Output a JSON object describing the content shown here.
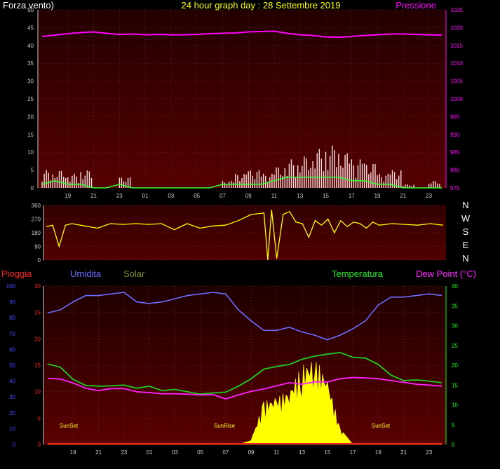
{
  "top": {
    "left_label": "Forza vento)",
    "title": "24 hour graph day : 28 Settembre 2019",
    "right_label": "Pressione"
  },
  "bottom": {
    "labels": {
      "rain": "Pioggia",
      "humidity": "Umidita",
      "solar": "Solar",
      "temperature": "Temperatura",
      "dewpoint": "Dew Point (°C)"
    },
    "annotations": [
      "SunSet",
      "SunRise",
      "SunSet"
    ]
  },
  "wind_dir_labels": [
    "N",
    "W",
    "S",
    "E",
    "N"
  ],
  "colors": {
    "pressure": "#ff00ff",
    "wind_gust": "#ffe0e0",
    "wind_avg": "#33ff33",
    "direction": "#ffff00",
    "humidity": "#6c6cff",
    "temperature": "#22cc22",
    "dewpoint": "#ff22ff",
    "solar": "#ffff00",
    "rain": "#ff2020",
    "axis_blue": "#4848ff",
    "axis_green": "#00ff00",
    "title_yellow": "#ffff00"
  },
  "chart_data": [
    {
      "type": "line",
      "name": "wind_pressure",
      "x_ticks": [
        "19",
        "21",
        "23",
        "01",
        "03",
        "05",
        "07",
        "09",
        "11",
        "13",
        "15",
        "17",
        "19",
        "21",
        "23"
      ],
      "hours": [
        17,
        18,
        19,
        20,
        21,
        22,
        23,
        0,
        1,
        2,
        3,
        4,
        5,
        6,
        7,
        8,
        9,
        10,
        11,
        12,
        13,
        14,
        15,
        16,
        17,
        18,
        19,
        20,
        21,
        22,
        23,
        24
      ],
      "y_left_ticks": [
        "50",
        "45",
        "40",
        "35",
        "30",
        "25",
        "20",
        "15",
        "10",
        "5",
        "0"
      ],
      "y_left_range": [
        0,
        50
      ],
      "y_right_ticks": [
        "1025",
        "1020",
        "1015",
        "1010",
        "1005",
        "1000",
        "995",
        "990",
        "985",
        "980",
        "975"
      ],
      "y_right_range": [
        975,
        1025
      ],
      "series": [
        {
          "name": "Pressione",
          "values": [
            1017.5,
            1017.9,
            1018.3,
            1018.6,
            1018.8,
            1018.4,
            1018.1,
            1018.2,
            1018.0,
            1018.1,
            1018.0,
            1018.0,
            1018.1,
            1018.3,
            1018.4,
            1018.5,
            1018.8,
            1018.9,
            1019.0,
            1018.4,
            1018.0,
            1017.8,
            1017.4,
            1017.3,
            1017.5,
            1017.8,
            1018.0,
            1018.2,
            1018.2,
            1018.1,
            1018.0,
            1017.9
          ]
        },
        {
          "values": [
            5,
            5,
            4,
            5,
            0,
            0,
            3,
            0,
            0,
            0,
            0,
            0,
            0,
            0,
            2,
            4,
            5,
            4,
            6,
            8,
            9,
            11,
            12,
            10,
            8,
            7,
            4,
            5,
            1,
            0,
            2,
            0
          ]
        },
        {
          "values": [
            1,
            2,
            1,
            1,
            0,
            0,
            1,
            0,
            0,
            0,
            0,
            0,
            0,
            0,
            1,
            1,
            1,
            1,
            2,
            3,
            3,
            3,
            3,
            3,
            2,
            2,
            1,
            1,
            0,
            0,
            0,
            0
          ]
        }
      ]
    },
    {
      "type": "line",
      "name": "wind_direction",
      "y_ticks": [
        "360",
        "270",
        "180",
        "90",
        "0"
      ],
      "y_range": [
        0,
        360
      ],
      "hours": [
        17,
        17.5,
        18,
        18.5,
        19,
        20,
        21,
        22,
        23,
        0,
        1,
        2,
        3,
        4,
        5,
        6,
        7,
        8,
        9,
        10,
        10.3,
        10.6,
        11,
        11.5,
        12,
        12.5,
        13,
        13.5,
        14,
        14.5,
        15,
        15.5,
        16,
        16.5,
        17,
        17.5,
        18,
        18.5,
        19,
        20,
        21,
        22,
        23,
        24
      ],
      "values": [
        220,
        230,
        90,
        230,
        240,
        225,
        210,
        240,
        235,
        240,
        235,
        240,
        200,
        240,
        210,
        225,
        230,
        260,
        300,
        310,
        0,
        330,
        10,
        300,
        320,
        250,
        240,
        150,
        260,
        230,
        270,
        180,
        260,
        220,
        250,
        240,
        210,
        250,
        230,
        240,
        235,
        230,
        240,
        230
      ]
    },
    {
      "type": "line",
      "name": "weather",
      "x_ticks": [
        "19",
        "21",
        "23",
        "01",
        "03",
        "05",
        "07",
        "09",
        "11",
        "13",
        "15",
        "17",
        "19",
        "21",
        "23"
      ],
      "y_rain_ticks": [
        "30",
        "25",
        "20",
        "15",
        "10",
        "5",
        "0"
      ],
      "y_rain_range": [
        0,
        30
      ],
      "y_humidity_ticks": [
        "100",
        "90",
        "80",
        "70",
        "60",
        "50",
        "40",
        "30",
        "20",
        "10",
        "0"
      ],
      "y_humidity_range": [
        0,
        100
      ],
      "y_temp_ticks": [
        "40",
        "35",
        "30",
        "25",
        "20",
        "15",
        "10",
        "5",
        "0"
      ],
      "y_temp_range": [
        0,
        40
      ],
      "hours": [
        17,
        18,
        19,
        20,
        21,
        22,
        23,
        0,
        1,
        2,
        3,
        4,
        5,
        6,
        7,
        8,
        9,
        10,
        11,
        12,
        13,
        14,
        15,
        16,
        17,
        18,
        19,
        20,
        21,
        22,
        23,
        24
      ],
      "series": [
        {
          "name": "Umidita",
          "values": [
            83,
            85,
            90,
            94,
            94,
            95,
            96,
            90,
            89,
            90,
            92,
            94,
            95,
            96,
            95,
            85,
            78,
            72,
            72,
            74,
            71,
            69,
            66,
            69,
            73,
            78,
            88,
            93,
            93,
            94,
            95,
            94
          ]
        },
        {
          "name": "Temperatura",
          "values": [
            20.3,
            19.5,
            16.4,
            14.9,
            14.7,
            14.8,
            15.0,
            14.2,
            14.7,
            13.6,
            13.9,
            13.3,
            12.7,
            13.0,
            13.2,
            14.7,
            16.6,
            19.0,
            19.7,
            20.2,
            21.5,
            22.3,
            22.8,
            23.2,
            22.0,
            21.8,
            20.2,
            17.5,
            16.1,
            16.3,
            16.0,
            15.6
          ]
        },
        {
          "name": "Dew Point (°C)",
          "values": [
            16.7,
            16.5,
            15.5,
            14.2,
            13.6,
            14.1,
            14.1,
            13.3,
            13.1,
            12.8,
            12.8,
            12.7,
            12.5,
            12.6,
            11.5,
            12.5,
            13.4,
            14.0,
            14.8,
            15.6,
            15.2,
            15.8,
            15.8,
            16.6,
            16.9,
            16.8,
            16.6,
            16.1,
            15.7,
            15.2,
            15.0,
            14.7
          ]
        },
        {
          "name": "Solar",
          "values": [
            0,
            0,
            0,
            0,
            0,
            0,
            0,
            0,
            0,
            0,
            0,
            0,
            0,
            0,
            0,
            0,
            1,
            11,
            12,
            14,
            20,
            22,
            17,
            4,
            0,
            0,
            0,
            0,
            0,
            0,
            0,
            0
          ]
        },
        {
          "name": "Pioggia",
          "values": [
            0,
            0,
            0,
            0,
            0,
            0,
            0,
            0,
            0,
            0,
            0,
            0,
            0,
            0,
            0,
            0,
            0,
            0,
            0,
            0,
            0,
            0,
            0,
            0,
            0,
            0,
            0,
            0,
            0,
            0,
            0,
            0
          ]
        }
      ]
    }
  ]
}
